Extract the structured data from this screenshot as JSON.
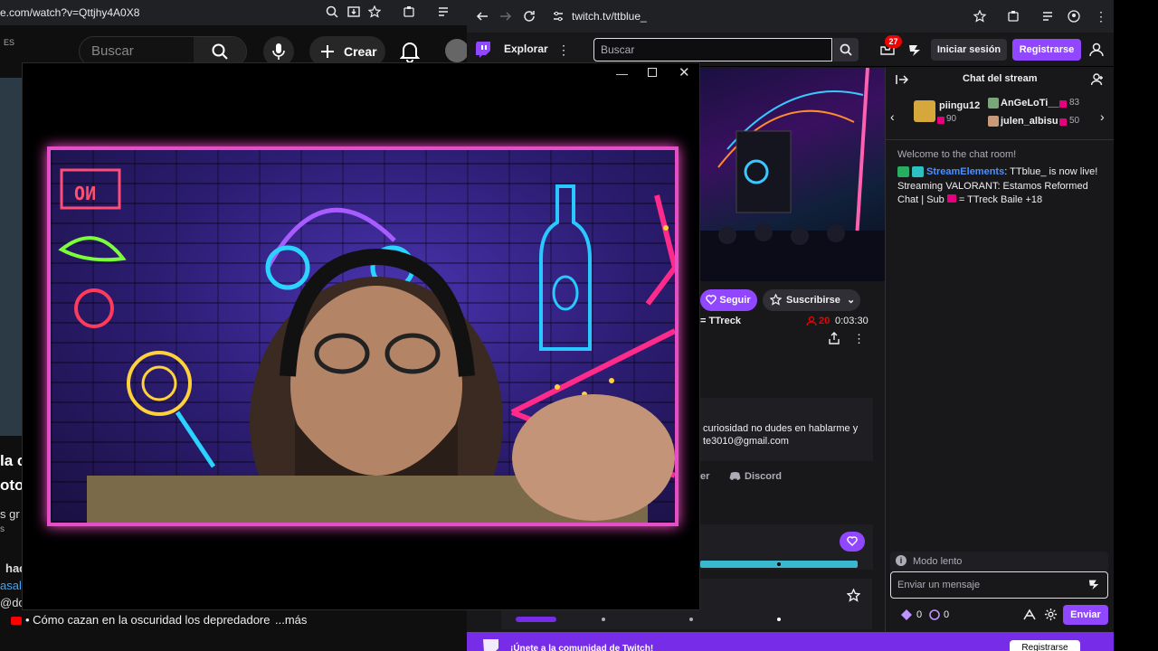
{
  "youtube": {
    "url": "e.com/watch?v=Qttjhy4A0X8",
    "lang": "ES",
    "search_placeholder": "Buscar",
    "create_label": "Crear",
    "title_frag1": "la c",
    "title_frag2": "oto",
    "title_frag3": "s gr",
    "meta_frag1": "s",
    "comment_frag1": "hac",
    "comment_frag2": "asal",
    "comment_frag3": "@do",
    "description": "• Cómo cazan en la oscuridad los depredadore",
    "more_label": "...más"
  },
  "twitch": {
    "url": "twitch.tv/ttblue_",
    "explore_label": "Explorar",
    "search_placeholder": "Buscar",
    "notif_count": "27",
    "login_label": "Iniciar sesión",
    "register_label": "Registrarse",
    "follow_label": "Seguir",
    "subscribe_label": "Suscribirse",
    "game_text": "= TTreck",
    "viewers": "20",
    "uptime": "0:03:30",
    "about_line1": "curiosidad no dudes en hablarme y",
    "about_line2": "te3010@gmail.com",
    "link_er": "er",
    "discord_label": "Discord",
    "footer_text": "¡Únete a la comunidad de Twitch!",
    "footer_button": "Registrarse",
    "colors": {
      "brand": "#9147ff",
      "live": "#eb0400"
    }
  },
  "chat": {
    "title": "Chat del stream",
    "hype": [
      {
        "user": "piingu12",
        "count": "90"
      },
      {
        "user": "AnGeLoTi__",
        "count": "83"
      },
      {
        "user": "julen_albisu",
        "count": "50"
      }
    ],
    "welcome": "Welcome to the chat room!",
    "message_author": "StreamElements",
    "message_text": ": TTblue_ is now live! Streaming VALORANT: Estamos Reformed Chat | Sub ",
    "message_suffix": "= TTreck Baile +18",
    "slow_mode": "Modo lento",
    "input_placeholder": "Enviar un mensaje",
    "points_a": "0",
    "points_b": "0",
    "send_label": "Enviar"
  },
  "stream_overlay": {
    "neon_sign": "NO"
  }
}
